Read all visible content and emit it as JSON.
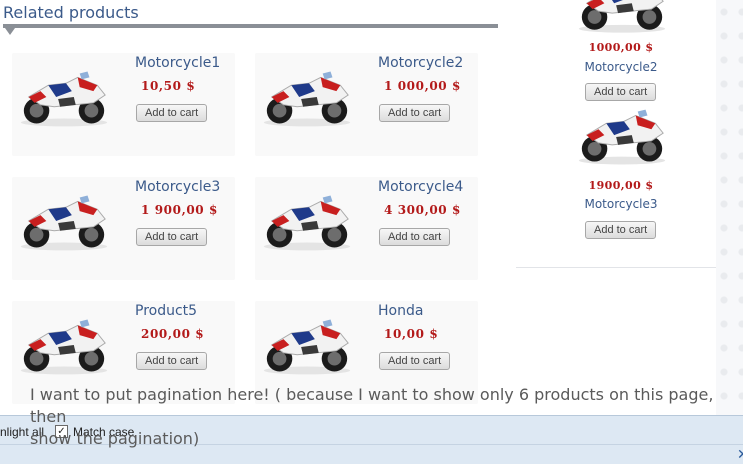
{
  "section": {
    "title": "Related products"
  },
  "products": [
    {
      "name": "Motorcycle1",
      "price": "10,50 $",
      "button": "Add to cart"
    },
    {
      "name": "Motorcycle2",
      "price": "1 000,00 $",
      "button": "Add to cart"
    },
    {
      "name": "Motorcycle3",
      "price": "1 900,00 $",
      "button": "Add to cart"
    },
    {
      "name": "Motorcycle4",
      "price": "4 300,00 $",
      "button": "Add to cart"
    },
    {
      "name": "Product5",
      "price": "200,00 $",
      "button": "Add to cart"
    },
    {
      "name": "Honda",
      "price": "10,00 $",
      "button": "Add to cart"
    }
  ],
  "sidebar": {
    "items": [
      {
        "price": "1000,00 $",
        "name": "Motorcycle2",
        "button": "Add to cart"
      },
      {
        "price": "1900,00 $",
        "name": "Motorcycle3",
        "button": "Add to cart"
      }
    ]
  },
  "note": {
    "line1": "I want to put pagination here! ( because I want to show only 6 products on this page, then",
    "line2": "show the pagination)"
  },
  "findbar": {
    "highlight_label": "nlight all",
    "match_case_label": "Match case",
    "match_case_checked": true,
    "close_icon": "close-icon"
  },
  "colors": {
    "price": "#b31a1a",
    "link": "#3b5a8a",
    "findbar": "#dde8f3"
  }
}
